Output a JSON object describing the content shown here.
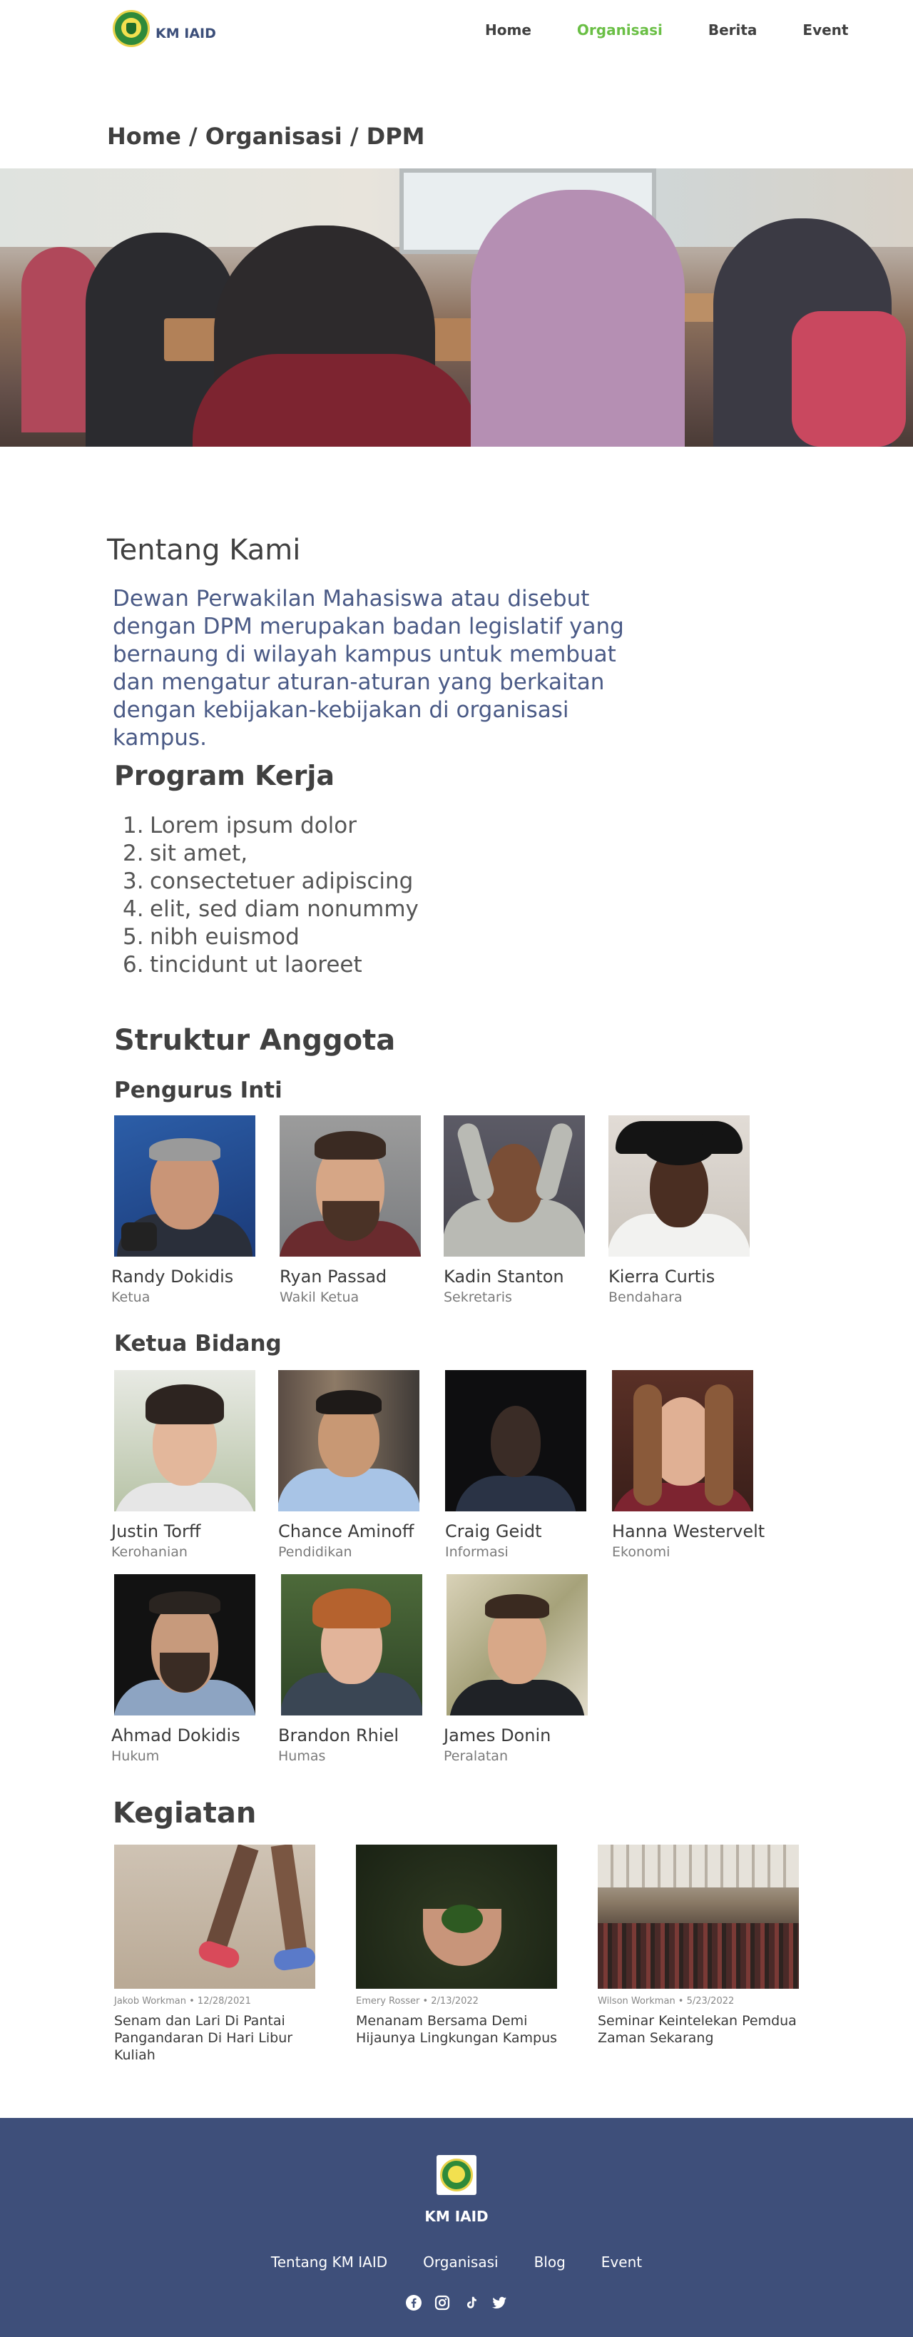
{
  "brand": {
    "name": "KM IAID"
  },
  "nav": {
    "items": [
      {
        "label": "Home",
        "active": false
      },
      {
        "label": "Organisasi",
        "active": true
      },
      {
        "label": "Berita",
        "active": false
      },
      {
        "label": "Event",
        "active": false
      }
    ],
    "active_color": "#6abf45"
  },
  "breadcrumb": "Home / Organisasi / DPM",
  "about": {
    "heading": "Tentang Kami",
    "text": "Dewan Perwakilan Mahasiswa atau disebut dengan DPM merupakan badan legislatif yang bernaung di wilayah kampus untuk membuat dan mengatur aturan-aturan yang berkaitan dengan kebijakan-kebijakan di organisasi kampus."
  },
  "program": {
    "heading": "Program Kerja",
    "items": [
      {
        "num": "1.",
        "text": "Lorem ipsum dolor"
      },
      {
        "num": "2.",
        "text": "sit amet,"
      },
      {
        "num": "3.",
        "text": "consectetuer adipiscing"
      },
      {
        "num": "4.",
        "text": "elit, sed diam nonummy"
      },
      {
        "num": "5.",
        "text": "nibh euismod"
      },
      {
        "num": "6.",
        "text": "tincidunt ut laoreet"
      }
    ]
  },
  "struktur": {
    "heading": "Struktur Anggota",
    "inti": {
      "heading": "Pengurus Inti",
      "members": [
        {
          "name": "Randy Dokidis",
          "role": "Ketua"
        },
        {
          "name": "Ryan Passad",
          "role": "Wakil Ketua"
        },
        {
          "name": "Kadin Stanton",
          "role": "Sekretaris"
        },
        {
          "name": "Kierra Curtis",
          "role": "Bendahara"
        }
      ]
    },
    "bidang": {
      "heading": "Ketua Bidang",
      "members": [
        {
          "name": "Justin Torff",
          "role": "Kerohanian"
        },
        {
          "name": "Chance Aminoff",
          "role": "Pendidikan"
        },
        {
          "name": "Craig Geidt",
          "role": "Informasi"
        },
        {
          "name": "Hanna Westervelt",
          "role": "Ekonomi"
        },
        {
          "name": "Ahmad Dokidis",
          "role": "Hukum"
        },
        {
          "name": "Brandon Rhiel",
          "role": "Humas"
        },
        {
          "name": "James Donin",
          "role": "Peralatan"
        }
      ]
    }
  },
  "kegiatan": {
    "heading": "Kegiatan",
    "events": [
      {
        "meta": "Jakob Workman • 12/28/2021",
        "title": "Senam dan Lari Di Pantai Pangandaran Di Hari Libur Kuliah"
      },
      {
        "meta": "Emery Rosser • 2/13/2022",
        "title": "Menanam Bersama Demi Hijaunya Lingkungan Kampus"
      },
      {
        "meta": "Wilson Workman • 5/23/2022",
        "title": "Seminar Keintelekan Pemdua Zaman Sekarang"
      }
    ]
  },
  "footer": {
    "name": "KM IAID",
    "links": [
      "Tentang KM IAID",
      "Organisasi",
      "Blog",
      "Event"
    ],
    "socials": [
      "facebook-icon",
      "instagram-icon",
      "tiktok-icon",
      "twitter-icon"
    ],
    "background": "#3e4f7a"
  }
}
